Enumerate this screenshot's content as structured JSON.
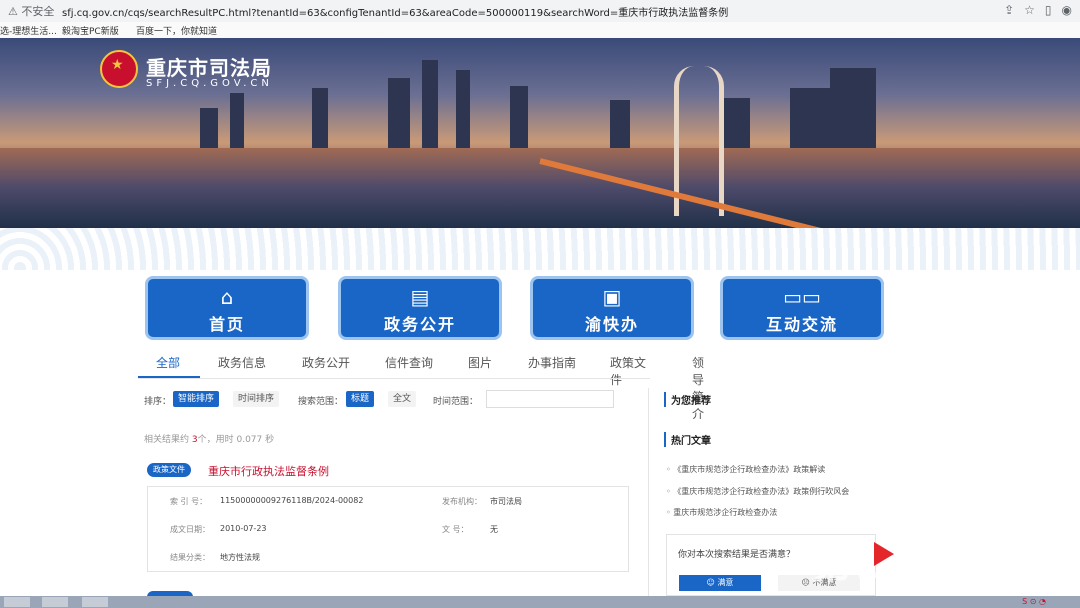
{
  "browser": {
    "security_label": "不安全",
    "url": "sfj.cq.gov.cn/cqs/searchResultPC.html?tenantId=63&configTenantId=63&areaCode=500000119&searchWord=重庆市行政执法监督条例",
    "bookmarks": [
      "选-理想生活...",
      "毅淘宝PC新版",
      "百度一下，你就知道"
    ]
  },
  "header": {
    "site_name": "重庆市司法局",
    "site_domain": "SFJ.CQ.GOV.CN"
  },
  "nav_boxes": [
    {
      "label": "首页",
      "icon": "home-icon"
    },
    {
      "label": "政务公开",
      "icon": "document-icon"
    },
    {
      "label": "渝快办",
      "icon": "id-card-icon"
    },
    {
      "label": "互动交流",
      "icon": "chat-icon"
    }
  ],
  "tabs": [
    "全部",
    "政务信息",
    "政务公开",
    "信件查询",
    "图片",
    "办事指南",
    "政策文件",
    "领导简介"
  ],
  "filters": {
    "sort_label": "排序：",
    "sort_smart": "智能排序",
    "sort_time": "时间排序",
    "scope_label": "搜索范围：",
    "scope_title": "标题",
    "scope_full": "全文",
    "time_label": "时间范围："
  },
  "results_summary": {
    "prefix": "相关结果约",
    "count": "3",
    "suffix": "个，用时 0.077 秒"
  },
  "results": [
    {
      "badge": "政策文件",
      "title": "重庆市行政执法监督条例",
      "index_label": "索  引  号：",
      "index_value": "11500000009276118B/2024-00082",
      "org_label": "发布机构：",
      "org_value": "市司法局",
      "date_label": "成文日期：",
      "date_value": "2010-07-23",
      "doc_label": "文      号：",
      "doc_value": "无",
      "category_label": "结果分类：",
      "category_value": "地方性法规"
    }
  ],
  "sidebar": {
    "recommend_title": "为您推荐",
    "hot_title": "热门文章",
    "hot_items": [
      "《重庆市规范涉企行政检查办法》政策解读",
      "《重庆市规范涉企行政检查办法》政策例行吹风会",
      "重庆市规范涉企行政检查办法"
    ],
    "survey_question": "你对本次搜索结果是否满意？",
    "survey_yes": "满意",
    "survey_no": "不满意"
  },
  "watermark": "第1眼TV",
  "colors": {
    "primary": "#1a66c6",
    "accent_red": "#c8102e"
  }
}
